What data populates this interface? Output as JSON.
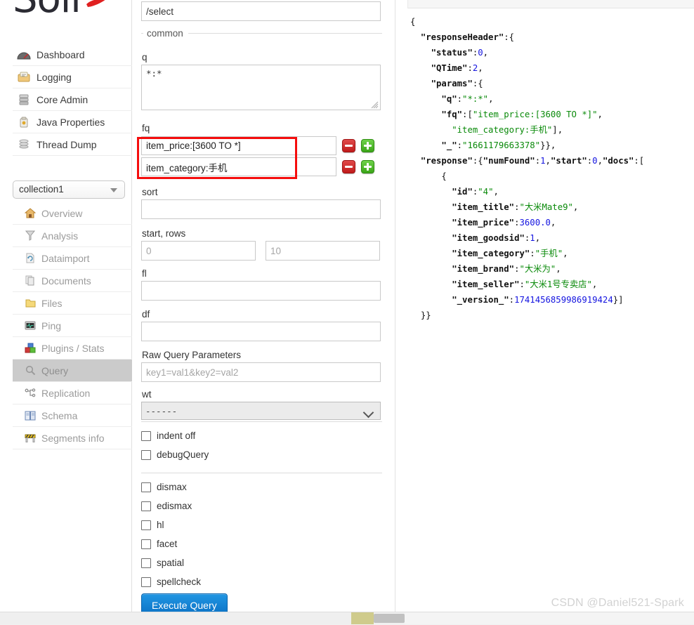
{
  "brand": {
    "logo_text": "Solr"
  },
  "sidebar": {
    "top_items": [
      {
        "label": "Dashboard",
        "icon": "dashboard-icon"
      },
      {
        "label": "Logging",
        "icon": "logging-icon"
      },
      {
        "label": "Core Admin",
        "icon": "core-admin-icon"
      },
      {
        "label": "Java Properties",
        "icon": "java-properties-icon"
      },
      {
        "label": "Thread Dump",
        "icon": "thread-dump-icon"
      }
    ],
    "collection_selected": "collection1",
    "core_items": [
      {
        "label": "Overview",
        "icon": "home-icon",
        "active": false
      },
      {
        "label": "Analysis",
        "icon": "funnel-icon",
        "active": false
      },
      {
        "label": "Dataimport",
        "icon": "dataimport-icon",
        "active": false
      },
      {
        "label": "Documents",
        "icon": "documents-icon",
        "active": false
      },
      {
        "label": "Files",
        "icon": "folder-icon",
        "active": false
      },
      {
        "label": "Ping",
        "icon": "ping-icon",
        "active": false
      },
      {
        "label": "Plugins / Stats",
        "icon": "plugins-icon",
        "active": false
      },
      {
        "label": "Query",
        "icon": "magnifier-icon",
        "active": true
      },
      {
        "label": "Replication",
        "icon": "replication-icon",
        "active": false
      },
      {
        "label": "Schema",
        "icon": "schema-icon",
        "active": false
      },
      {
        "label": "Segments info",
        "icon": "segments-icon",
        "active": false
      }
    ]
  },
  "form": {
    "handler_value": "/select",
    "fieldset_legend": "common",
    "q_label": "q",
    "q_value": "*:*",
    "fq_label": "fq",
    "fq_values": [
      "item_price:[3600 TO *]",
      "item_category:手机"
    ],
    "sort_label": "sort",
    "sort_value": "",
    "startrows_label": "start, rows",
    "start_placeholder": "0",
    "rows_placeholder": "10",
    "start_value": "",
    "rows_value": "",
    "fl_label": "fl",
    "fl_value": "",
    "df_label": "df",
    "df_value": "",
    "raw_label": "Raw Query Parameters",
    "raw_placeholder": "key1=val1&key2=val2",
    "raw_value": "",
    "wt_label": "wt",
    "wt_selected": "------",
    "checkboxes_group1": [
      {
        "label": "indent off",
        "checked": false
      },
      {
        "label": "debugQuery",
        "checked": false
      }
    ],
    "checkboxes_group2": [
      {
        "label": "dismax",
        "checked": false
      },
      {
        "label": "edismax",
        "checked": false,
        "bold_prefix": "e"
      },
      {
        "label": "hl",
        "checked": false
      },
      {
        "label": "facet",
        "checked": false
      },
      {
        "label": "spatial",
        "checked": false
      },
      {
        "label": "spellcheck",
        "checked": false
      }
    ],
    "execute_label": "Execute Query",
    "highlight_color": "#f50d0d"
  },
  "response": {
    "responseHeader": {
      "status": 0,
      "QTime": 2,
      "params": {
        "q": "*:*",
        "fq": [
          "item_price:[3600 TO *]",
          "item_category:手机"
        ],
        "_": "1661179663378"
      }
    },
    "result": {
      "numFound": 1,
      "start": 0,
      "docs": [
        {
          "id": "4",
          "item_title": "大米Mate9",
          "item_price": "3600.0",
          "item_goodsid": "1",
          "item_category": "手机",
          "item_brand": "大米为",
          "item_seller": "大米1号专卖店",
          "_version_": "1741456859986919424"
        }
      ]
    },
    "raw_text": "{\n  \"responseHeader\":{\n    \"status\":0,\n    \"QTime\":2,\n    \"params\":{\n      \"q\":\"*:*\",\n      \"fq\":[\"item_price:[3600 TO *]\",\n        \"item_category:手机\"],\n      \"_\":\"1661179663378\"}},\n  \"response\":{\"numFound\":1,\"start\":0,\"docs\":[\n      {\n        \"id\":\"4\",\n        \"item_title\":\"大米Mate9\",\n        \"item_price\":3600.0,\n        \"item_goodsid\":1,\n        \"item_category\":\"手机\",\n        \"item_brand\":\"大米为\",\n        \"item_seller\":\"大米1号专卖店\",\n        \"_version_\":1741456859986919424}]\n  }}"
  },
  "watermark": {
    "text": "CSDN @Daniel521-Spark"
  },
  "colors": {
    "accent_button": "#0a6fc2",
    "highlight_box": "#f50d0d",
    "json_string": "#0a8a0a",
    "json_number": "#1414e0",
    "active_nav_bg": "#cbcbcb"
  }
}
